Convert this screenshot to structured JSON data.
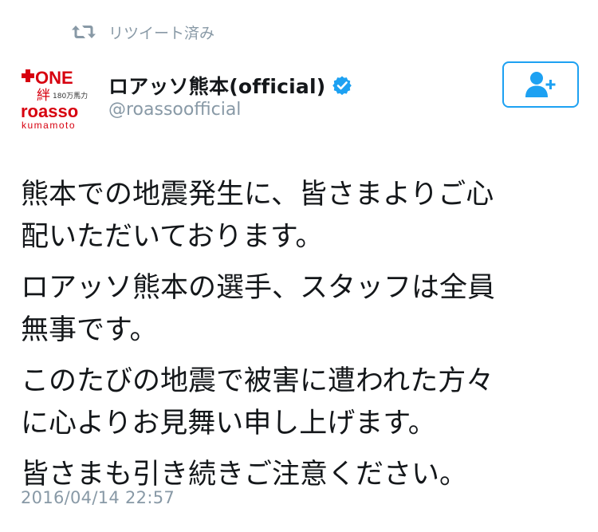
{
  "retweet": {
    "label": "リツイート済み",
    "icon": "retweet-icon"
  },
  "author": {
    "display_name": "ロアッソ熊本(official)",
    "handle": "@roassoofficial",
    "verified_icon": "verified-badge-icon",
    "avatar": {
      "logo_top": "ONE",
      "logo_kanji": "絆",
      "logo_sub": "180万馬力",
      "logo_brand": "roasso",
      "logo_city": "kumamoto"
    }
  },
  "follow_button": {
    "icon": "add-user-icon"
  },
  "tweet": {
    "paragraphs": [
      {
        "lines": [
          "熊本での地震発生に、皆さまよりご心",
          "配いただいております。"
        ]
      },
      {
        "lines": [
          "ロアッソ熊本の選手、スタッフは全員",
          "無事です。"
        ]
      },
      {
        "lines": [
          "このたびの地震で被害に遭われた方々",
          "に心よりお見舞い申し上げます。"
        ]
      },
      {
        "lines": [
          "皆さまも引き続きご注意ください。"
        ]
      }
    ]
  },
  "timestamp": "2016/04/14 22:57",
  "colors": {
    "accent": "#1da1f2",
    "muted": "#8899a6",
    "text": "#14171a",
    "brand_red": "#d7000f"
  }
}
